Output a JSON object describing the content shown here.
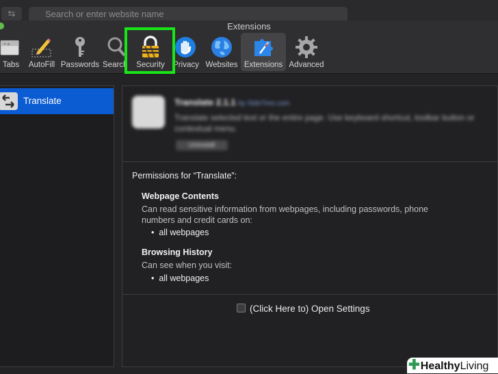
{
  "browser": {
    "back_glyph": "⇆",
    "url_placeholder": "Search or enter website name"
  },
  "window": {
    "title": "Extensions"
  },
  "toolbar": {
    "items": [
      {
        "label": "Tabs",
        "icon": "tabs-icon"
      },
      {
        "label": "AutoFill",
        "icon": "autofill-pencil-icon"
      },
      {
        "label": "Passwords",
        "icon": "key-icon"
      },
      {
        "label": "Search",
        "icon": "magnifier-icon"
      },
      {
        "label": "Security",
        "icon": "lock-icon"
      },
      {
        "label": "Privacy",
        "icon": "hand-icon"
      },
      {
        "label": "Websites",
        "icon": "globe-icon"
      },
      {
        "label": "Extensions",
        "icon": "compass-puzzle-icon"
      },
      {
        "label": "Advanced",
        "icon": "gear-icon"
      }
    ],
    "selected": "Extensions",
    "highlighted": "Security"
  },
  "extension_list": {
    "items": [
      {
        "name": "Translate"
      }
    ]
  },
  "extension_info": {
    "title": "Translate 2.1.1",
    "author": "by SideTree.com",
    "description": "Translate selected text or the entire page. Use keyboard shortcut, toolbar button or contextual menu.",
    "uninstall_label": "Uninstall"
  },
  "permissions": {
    "heading": "Permissions for “Translate”:",
    "webpage_contents": {
      "title": "Webpage Contents",
      "desc": "Can read sensitive information from webpages, including passwords, phone numbers and credit cards on:",
      "item": "all webpages"
    },
    "browsing_history": {
      "title": "Browsing History",
      "desc": "Can see when you visit:",
      "item": "all webpages"
    }
  },
  "settings": {
    "label": "(Click Here to) Open Settings"
  },
  "watermark": {
    "brand_strong": "Healthy",
    "brand_light": "Living"
  },
  "colors": {
    "selection": "#0b5bd3",
    "highlight": "#18e617",
    "brand": "#2e9a52"
  }
}
